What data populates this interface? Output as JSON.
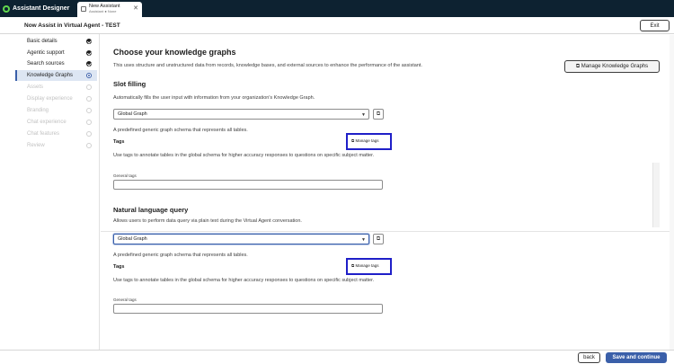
{
  "app": {
    "title": "Assistant Designer",
    "brand_color": "#62d84e"
  },
  "tab": {
    "title": "New Assistant",
    "subtitle": "Assistant ● None",
    "close_glyph": "✕"
  },
  "header": {
    "title": "Now Assist in Virtual Agent - TEST",
    "exit_label": "Exit"
  },
  "sidebar": {
    "items": [
      {
        "label": "Basic details",
        "status": "done"
      },
      {
        "label": "Agentic support",
        "status": "done"
      },
      {
        "label": "Search sources",
        "status": "done"
      },
      {
        "label": "Knowledge Graphs",
        "status": "current"
      },
      {
        "label": "Assets",
        "status": "pending"
      },
      {
        "label": "Display experience",
        "status": "pending"
      },
      {
        "label": "Branding",
        "status": "pending"
      },
      {
        "label": "Chat experience",
        "status": "pending"
      },
      {
        "label": "Chat features",
        "status": "pending"
      },
      {
        "label": "Review",
        "status": "pending"
      }
    ]
  },
  "main": {
    "title": "Choose your knowledge graphs",
    "description": "This uses structure and unstructured data from records, knowledge bases, and external sources to enhance the performance of the assistant.",
    "manage_kg_label": "Manage Knowledge Graphs",
    "slot_filling": {
      "title": "Slot filling",
      "description": "Automatically fills the user input with information from your organization's Knowledge Graph.",
      "selected_graph": "Global Graph",
      "graph_note": "A predefined generic graph schema that represents all tables.",
      "tags_label": "Tags",
      "manage_tags_label": "Manage tags",
      "tags_description": "Use tags to annotate tables in the global schema for higher accuracy responses to questions on specific subject matter.",
      "general_tags_label": "General tags",
      "general_tags_value": ""
    },
    "nl_query": {
      "title": "Natural language query",
      "description": "Allows users to perform data query via plain text during the Virtual Agent conversation.",
      "selected_graph": "Global Graph",
      "graph_note": "A predefined generic graph schema that represents all tables.",
      "tags_label": "Tags",
      "manage_tags_label": "Manage tags",
      "tags_description": "Use tags to annotate tables in the global schema for higher accuracy responses to questions on specific subject matter.",
      "general_tags_label": "General tags",
      "general_tags_value": ""
    }
  },
  "footer": {
    "back_label": "back",
    "save_label": "Save and continue"
  },
  "colors": {
    "primary": "#3a5fa9",
    "topbar": "#0d2231",
    "highlight_box": "#1f1fc8"
  }
}
